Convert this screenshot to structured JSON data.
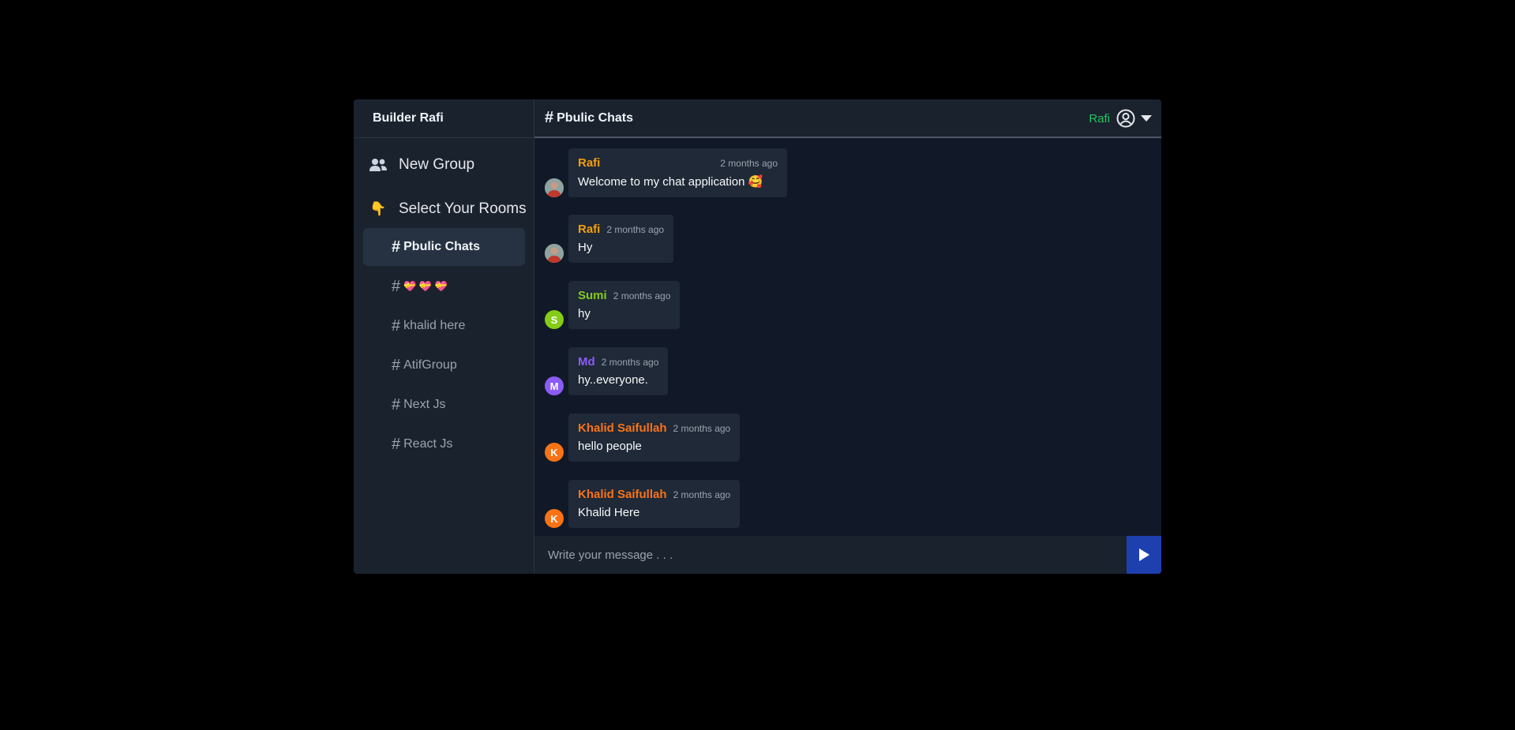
{
  "app": {
    "title": "Builder Rafi"
  },
  "sidebar": {
    "new_group_label": "New Group",
    "select_rooms_label": "Select Your Rooms",
    "select_rooms_emoji": "👇",
    "rooms": [
      {
        "hash": "#",
        "label": "Pbulic Chats",
        "active": true
      },
      {
        "hash": "#",
        "label": "💝 💝 💝",
        "active": false
      },
      {
        "hash": "#",
        "label": "khalid here",
        "active": false
      },
      {
        "hash": "#",
        "label": "AtifGroup",
        "active": false
      },
      {
        "hash": "#",
        "label": "Next Js",
        "active": false
      },
      {
        "hash": "#",
        "label": "React Js",
        "active": false
      }
    ]
  },
  "header": {
    "hash": "#",
    "room_title": "Pbulic Chats",
    "user_name": "Rafi"
  },
  "messages": [
    {
      "author": "Rafi",
      "author_color": "#f59e0b",
      "time": "2 months ago",
      "text": "Welcome to my chat application 🥰",
      "avatar_initial": ""
    },
    {
      "author": "Rafi",
      "author_color": "#f59e0b",
      "time": "2 months ago",
      "text": "Hy",
      "avatar_initial": ""
    },
    {
      "author": "Sumi",
      "author_color": "#84cc16",
      "time": "2 months ago",
      "text": "hy",
      "avatar_initial": "S",
      "avatar_color": "#84cc16"
    },
    {
      "author": "Md",
      "author_color": "#8b5cf6",
      "time": "2 months ago",
      "text": "hy..everyone.",
      "avatar_initial": "M",
      "avatar_color": "#8b5cf6"
    },
    {
      "author": "Khalid Saifullah",
      "author_color": "#f97316",
      "time": "2 months ago",
      "text": "hello people",
      "avatar_initial": "K",
      "avatar_color": "#f97316"
    },
    {
      "author": "Khalid Saifullah",
      "author_color": "#f97316",
      "time": "2 months ago",
      "text": "Khalid Here",
      "avatar_initial": "K",
      "avatar_color": "#f97316"
    }
  ],
  "composer": {
    "placeholder": "Write your message . . ."
  },
  "colors": {
    "send_button": "#1e40af",
    "online_user": "#22c55e"
  }
}
